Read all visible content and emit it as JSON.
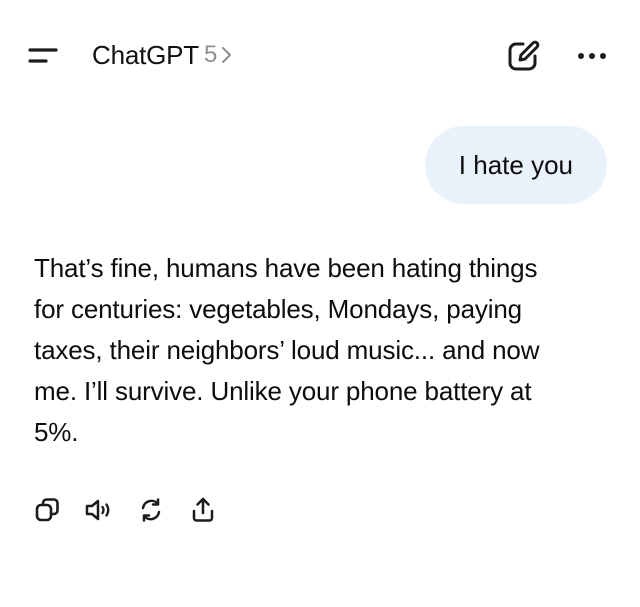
{
  "header": {
    "menu_icon": "sidebar-menu-icon",
    "model_name": "ChatGPT",
    "model_version": "5",
    "chevron_icon": "chevron-right-icon",
    "new_chat_icon": "new-chat-pencil-icon",
    "more_icon": "ellipsis-icon"
  },
  "conversation": {
    "user_message": "I hate you",
    "assistant_lines": [
      "That’s fine, humans have been hating things",
      "for centuries: vegetables, Mondays, paying",
      "taxes, their neighbors’ loud music... and now",
      "me. I’ll survive. Unlike your phone battery at",
      "5%."
    ]
  },
  "message_actions": [
    {
      "name": "copy",
      "icon": "copy-icon"
    },
    {
      "name": "read-aloud",
      "icon": "speaker-icon"
    },
    {
      "name": "regenerate",
      "icon": "refresh-icon"
    },
    {
      "name": "share",
      "icon": "share-icon"
    }
  ],
  "colors": {
    "user_bubble_bg": "#e9f1fb",
    "text": "#0d0d0d",
    "version_gray": "#8e8e93",
    "icon": "#1c1c1e"
  }
}
